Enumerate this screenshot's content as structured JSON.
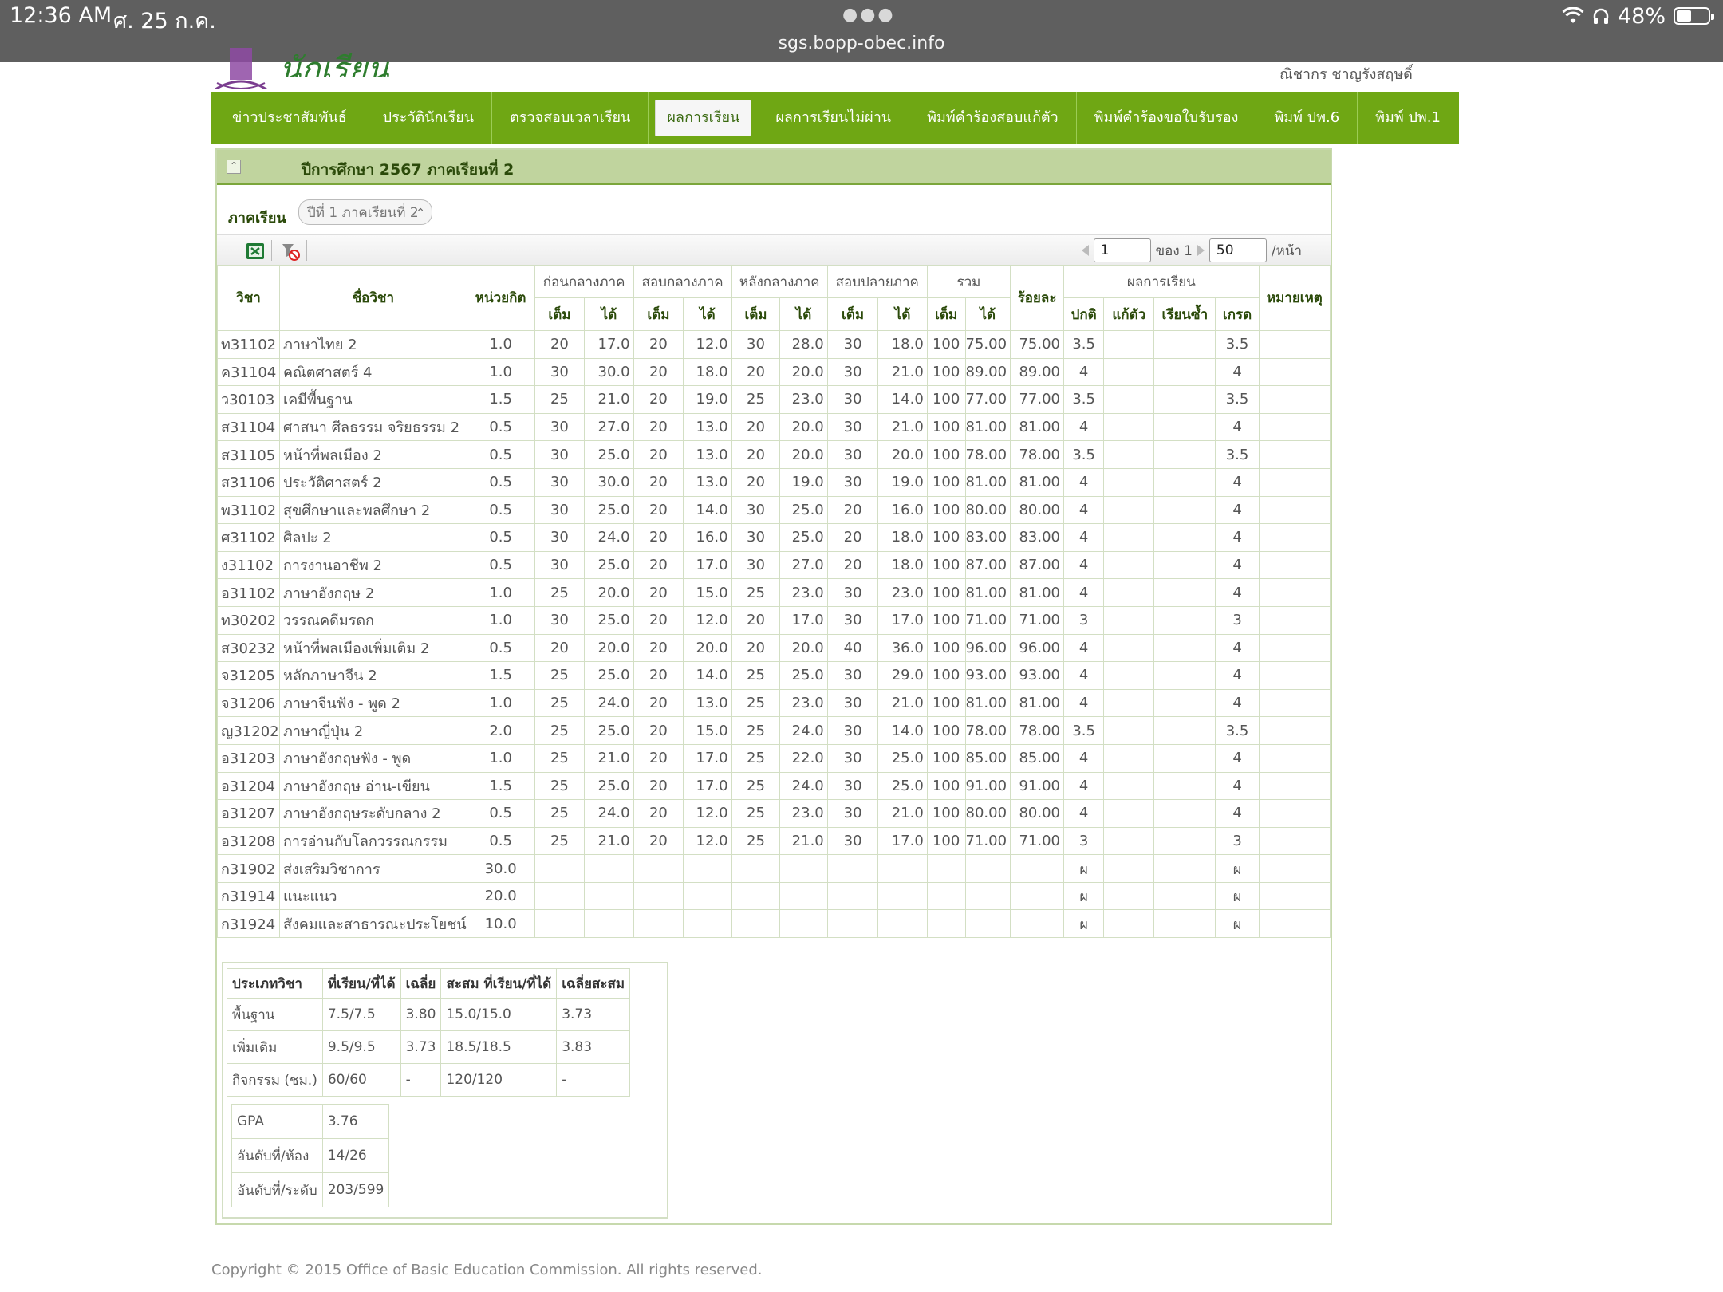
{
  "status_bar": {
    "time": "12:36 AM",
    "date": "ศ. 25 ก.ค.",
    "url": "sgs.bopp-obec.info",
    "battery": "48%",
    "battery_level": 0.48
  },
  "header": {
    "site_title": "นักเรียน",
    "user_name": "ณิชากร ชาญรังสฤษดิ์"
  },
  "nav": {
    "items": [
      {
        "label": "ข่าวประชาสัมพันธ์",
        "active": false
      },
      {
        "label": "ประวัตินักเรียน",
        "active": false
      },
      {
        "label": "ตรวจสอบเวลาเรียน",
        "active": false
      },
      {
        "label": "ผลการเรียน",
        "active": true
      },
      {
        "label": "ผลการเรียนไม่ผ่าน",
        "active": false
      },
      {
        "label": "พิมพ์คำร้องสอบแก้ตัว",
        "active": false
      },
      {
        "label": "พิมพ์คำร้องขอใบรับรอง",
        "active": false
      },
      {
        "label": "พิมพ์ ปพ.6",
        "active": false
      },
      {
        "label": "พิมพ์ ปพ.1",
        "active": false
      }
    ]
  },
  "panel": {
    "title": "ปีการศึกษา 2567 ภาคเรียนที่ 2",
    "term_label": "ภาคเรียน",
    "term_value": "ปีที่ 1 ภาคเรียนที่ 2"
  },
  "pager": {
    "page": "1",
    "of_label": "ของ 1",
    "page_size": "50",
    "per_page_label": "/หน้า"
  },
  "table": {
    "headers": {
      "code": "วิชา",
      "name": "ชื่อวิชา",
      "credit": "หน่วยกิต",
      "before_mid": "ก่อนกลางภาค",
      "mid_exam": "สอบกลางภาค",
      "after_mid": "หลังกลางภาค",
      "final_exam": "สอบปลายภาค",
      "total": "รวม",
      "percent": "ร้อยละ",
      "result": "ผลการเรียน",
      "remark": "หมายเหตุ",
      "full": "เต็ม",
      "got": "ได้",
      "normal": "ปกติ",
      "retake": "แก้ตัว",
      "repeat": "เรียนซ้ำ",
      "grade": "เกรด"
    },
    "rows": [
      {
        "code": "ท31102",
        "name": "ภาษาไทย 2",
        "credit": "1.0",
        "bf": "20",
        "bg": "17.0",
        "mf": "20",
        "mg": "12.0",
        "af": "30",
        "ag": "28.0",
        "ff": "30",
        "fg": "18.0",
        "tf": "100",
        "tg": "75.00",
        "pct": "75.00",
        "normal": "3.5",
        "retake": "",
        "repeat": "",
        "grade": "3.5",
        "remark": ""
      },
      {
        "code": "ค31104",
        "name": "คณิตศาสตร์ 4",
        "credit": "1.0",
        "bf": "30",
        "bg": "30.0",
        "mf": "20",
        "mg": "18.0",
        "af": "20",
        "ag": "20.0",
        "ff": "30",
        "fg": "21.0",
        "tf": "100",
        "tg": "89.00",
        "pct": "89.00",
        "normal": "4",
        "retake": "",
        "repeat": "",
        "grade": "4",
        "remark": ""
      },
      {
        "code": "ว30103",
        "name": "เคมีพื้นฐาน",
        "credit": "1.5",
        "bf": "25",
        "bg": "21.0",
        "mf": "20",
        "mg": "19.0",
        "af": "25",
        "ag": "23.0",
        "ff": "30",
        "fg": "14.0",
        "tf": "100",
        "tg": "77.00",
        "pct": "77.00",
        "normal": "3.5",
        "retake": "",
        "repeat": "",
        "grade": "3.5",
        "remark": ""
      },
      {
        "code": "ส31104",
        "name": "ศาสนา ศีลธรรม จริยธรรม 2",
        "credit": "0.5",
        "bf": "30",
        "bg": "27.0",
        "mf": "20",
        "mg": "13.0",
        "af": "20",
        "ag": "20.0",
        "ff": "30",
        "fg": "21.0",
        "tf": "100",
        "tg": "81.00",
        "pct": "81.00",
        "normal": "4",
        "retake": "",
        "repeat": "",
        "grade": "4",
        "remark": ""
      },
      {
        "code": "ส31105",
        "name": "หน้าที่พลเมือง 2",
        "credit": "0.5",
        "bf": "30",
        "bg": "25.0",
        "mf": "20",
        "mg": "13.0",
        "af": "20",
        "ag": "20.0",
        "ff": "30",
        "fg": "20.0",
        "tf": "100",
        "tg": "78.00",
        "pct": "78.00",
        "normal": "3.5",
        "retake": "",
        "repeat": "",
        "grade": "3.5",
        "remark": ""
      },
      {
        "code": "ส31106",
        "name": "ประวัติศาสตร์ 2",
        "credit": "0.5",
        "bf": "30",
        "bg": "30.0",
        "mf": "20",
        "mg": "13.0",
        "af": "20",
        "ag": "19.0",
        "ff": "30",
        "fg": "19.0",
        "tf": "100",
        "tg": "81.00",
        "pct": "81.00",
        "normal": "4",
        "retake": "",
        "repeat": "",
        "grade": "4",
        "remark": ""
      },
      {
        "code": "พ31102",
        "name": "สุขศึกษาและพลศึกษา 2",
        "credit": "0.5",
        "bf": "30",
        "bg": "25.0",
        "mf": "20",
        "mg": "14.0",
        "af": "30",
        "ag": "25.0",
        "ff": "20",
        "fg": "16.0",
        "tf": "100",
        "tg": "80.00",
        "pct": "80.00",
        "normal": "4",
        "retake": "",
        "repeat": "",
        "grade": "4",
        "remark": ""
      },
      {
        "code": "ศ31102",
        "name": "ศิลปะ 2",
        "credit": "0.5",
        "bf": "30",
        "bg": "24.0",
        "mf": "20",
        "mg": "16.0",
        "af": "30",
        "ag": "25.0",
        "ff": "20",
        "fg": "18.0",
        "tf": "100",
        "tg": "83.00",
        "pct": "83.00",
        "normal": "4",
        "retake": "",
        "repeat": "",
        "grade": "4",
        "remark": ""
      },
      {
        "code": "ง31102",
        "name": "การงานอาชีพ 2",
        "credit": "0.5",
        "bf": "30",
        "bg": "25.0",
        "mf": "20",
        "mg": "17.0",
        "af": "30",
        "ag": "27.0",
        "ff": "20",
        "fg": "18.0",
        "tf": "100",
        "tg": "87.00",
        "pct": "87.00",
        "normal": "4",
        "retake": "",
        "repeat": "",
        "grade": "4",
        "remark": ""
      },
      {
        "code": "อ31102",
        "name": "ภาษาอังกฤษ 2",
        "credit": "1.0",
        "bf": "25",
        "bg": "20.0",
        "mf": "20",
        "mg": "15.0",
        "af": "25",
        "ag": "23.0",
        "ff": "30",
        "fg": "23.0",
        "tf": "100",
        "tg": "81.00",
        "pct": "81.00",
        "normal": "4",
        "retake": "",
        "repeat": "",
        "grade": "4",
        "remark": ""
      },
      {
        "code": "ท30202",
        "name": "วรรณคดีมรดก",
        "credit": "1.0",
        "bf": "30",
        "bg": "25.0",
        "mf": "20",
        "mg": "12.0",
        "af": "20",
        "ag": "17.0",
        "ff": "30",
        "fg": "17.0",
        "tf": "100",
        "tg": "71.00",
        "pct": "71.00",
        "normal": "3",
        "retake": "",
        "repeat": "",
        "grade": "3",
        "remark": ""
      },
      {
        "code": "ส30232",
        "name": "หน้าที่พลเมืองเพิ่มเติม 2",
        "credit": "0.5",
        "bf": "20",
        "bg": "20.0",
        "mf": "20",
        "mg": "20.0",
        "af": "20",
        "ag": "20.0",
        "ff": "40",
        "fg": "36.0",
        "tf": "100",
        "tg": "96.00",
        "pct": "96.00",
        "normal": "4",
        "retake": "",
        "repeat": "",
        "grade": "4",
        "remark": ""
      },
      {
        "code": "จ31205",
        "name": "หลักภาษาจีน 2",
        "credit": "1.5",
        "bf": "25",
        "bg": "25.0",
        "mf": "20",
        "mg": "14.0",
        "af": "25",
        "ag": "25.0",
        "ff": "30",
        "fg": "29.0",
        "tf": "100",
        "tg": "93.00",
        "pct": "93.00",
        "normal": "4",
        "retake": "",
        "repeat": "",
        "grade": "4",
        "remark": ""
      },
      {
        "code": "จ31206",
        "name": "ภาษาจีนฟัง - พูด 2",
        "credit": "1.0",
        "bf": "25",
        "bg": "24.0",
        "mf": "20",
        "mg": "13.0",
        "af": "25",
        "ag": "23.0",
        "ff": "30",
        "fg": "21.0",
        "tf": "100",
        "tg": "81.00",
        "pct": "81.00",
        "normal": "4",
        "retake": "",
        "repeat": "",
        "grade": "4",
        "remark": ""
      },
      {
        "code": "ญ31202",
        "name": "ภาษาญี่ปุ่น 2",
        "credit": "2.0",
        "bf": "25",
        "bg": "25.0",
        "mf": "20",
        "mg": "15.0",
        "af": "25",
        "ag": "24.0",
        "ff": "30",
        "fg": "14.0",
        "tf": "100",
        "tg": "78.00",
        "pct": "78.00",
        "normal": "3.5",
        "retake": "",
        "repeat": "",
        "grade": "3.5",
        "remark": ""
      },
      {
        "code": "อ31203",
        "name": "ภาษาอังกฤษฟัง - พูด",
        "credit": "1.0",
        "bf": "25",
        "bg": "21.0",
        "mf": "20",
        "mg": "17.0",
        "af": "25",
        "ag": "22.0",
        "ff": "30",
        "fg": "25.0",
        "tf": "100",
        "tg": "85.00",
        "pct": "85.00",
        "normal": "4",
        "retake": "",
        "repeat": "",
        "grade": "4",
        "remark": ""
      },
      {
        "code": "อ31204",
        "name": "ภาษาอังกฤษ อ่าน-เขียน",
        "credit": "1.5",
        "bf": "25",
        "bg": "25.0",
        "mf": "20",
        "mg": "17.0",
        "af": "25",
        "ag": "24.0",
        "ff": "30",
        "fg": "25.0",
        "tf": "100",
        "tg": "91.00",
        "pct": "91.00",
        "normal": "4",
        "retake": "",
        "repeat": "",
        "grade": "4",
        "remark": ""
      },
      {
        "code": "อ31207",
        "name": "ภาษาอังกฤษระดับกลาง 2",
        "credit": "0.5",
        "bf": "25",
        "bg": "24.0",
        "mf": "20",
        "mg": "12.0",
        "af": "25",
        "ag": "23.0",
        "ff": "30",
        "fg": "21.0",
        "tf": "100",
        "tg": "80.00",
        "pct": "80.00",
        "normal": "4",
        "retake": "",
        "repeat": "",
        "grade": "4",
        "remark": ""
      },
      {
        "code": "อ31208",
        "name": "การอ่านกับโลกวรรณกรรม",
        "credit": "0.5",
        "bf": "25",
        "bg": "21.0",
        "mf": "20",
        "mg": "12.0",
        "af": "25",
        "ag": "21.0",
        "ff": "30",
        "fg": "17.0",
        "tf": "100",
        "tg": "71.00",
        "pct": "71.00",
        "normal": "3",
        "retake": "",
        "repeat": "",
        "grade": "3",
        "remark": ""
      },
      {
        "code": "ก31902",
        "name": "ส่งเสริมวิชาการ",
        "credit": "30.0",
        "bf": "",
        "bg": "",
        "mf": "",
        "mg": "",
        "af": "",
        "ag": "",
        "ff": "",
        "fg": "",
        "tf": "",
        "tg": "",
        "pct": "",
        "normal": "ผ",
        "retake": "",
        "repeat": "",
        "grade": "ผ",
        "remark": ""
      },
      {
        "code": "ก31914",
        "name": "แนะแนว",
        "credit": "20.0",
        "bf": "",
        "bg": "",
        "mf": "",
        "mg": "",
        "af": "",
        "ag": "",
        "ff": "",
        "fg": "",
        "tf": "",
        "tg": "",
        "pct": "",
        "normal": "ผ",
        "retake": "",
        "repeat": "",
        "grade": "ผ",
        "remark": ""
      },
      {
        "code": "ก31924",
        "name": "สังคมและสาธารณะประโยชน์",
        "credit": "10.0",
        "bf": "",
        "bg": "",
        "mf": "",
        "mg": "",
        "af": "",
        "ag": "",
        "ff": "",
        "fg": "",
        "tf": "",
        "tg": "",
        "pct": "",
        "normal": "ผ",
        "retake": "",
        "repeat": "",
        "grade": "ผ",
        "remark": ""
      }
    ]
  },
  "summary": {
    "headers": [
      "ประเภทวิชา",
      "ที่เรียน/ที่ได้",
      "เฉลี่ย",
      "สะสม ที่เรียน/ที่ได้",
      "เฉลี่ยสะสม"
    ],
    "rows": [
      [
        "พื้นฐาน",
        "7.5/7.5",
        "3.80",
        "15.0/15.0",
        "3.73"
      ],
      [
        "เพิ่มเติม",
        "9.5/9.5",
        "3.73",
        "18.5/18.5",
        "3.83"
      ],
      [
        "กิจกรรม (ชม.)",
        "60/60",
        "-",
        "120/120",
        "-"
      ]
    ],
    "gpa_rows": [
      [
        "GPA",
        "3.76"
      ],
      [
        "อันดับที่/ห้อง",
        "14/26"
      ],
      [
        "อันดับที่/ระดับ",
        "203/599"
      ]
    ]
  },
  "footer": {
    "copyright": "Copyright © 2015 Office of Basic Education Commission. All rights reserved."
  },
  "colors": {
    "nav_green": "#6fa714",
    "panel_head": "#c0d49e",
    "status_bar": "#5f5f5f"
  }
}
